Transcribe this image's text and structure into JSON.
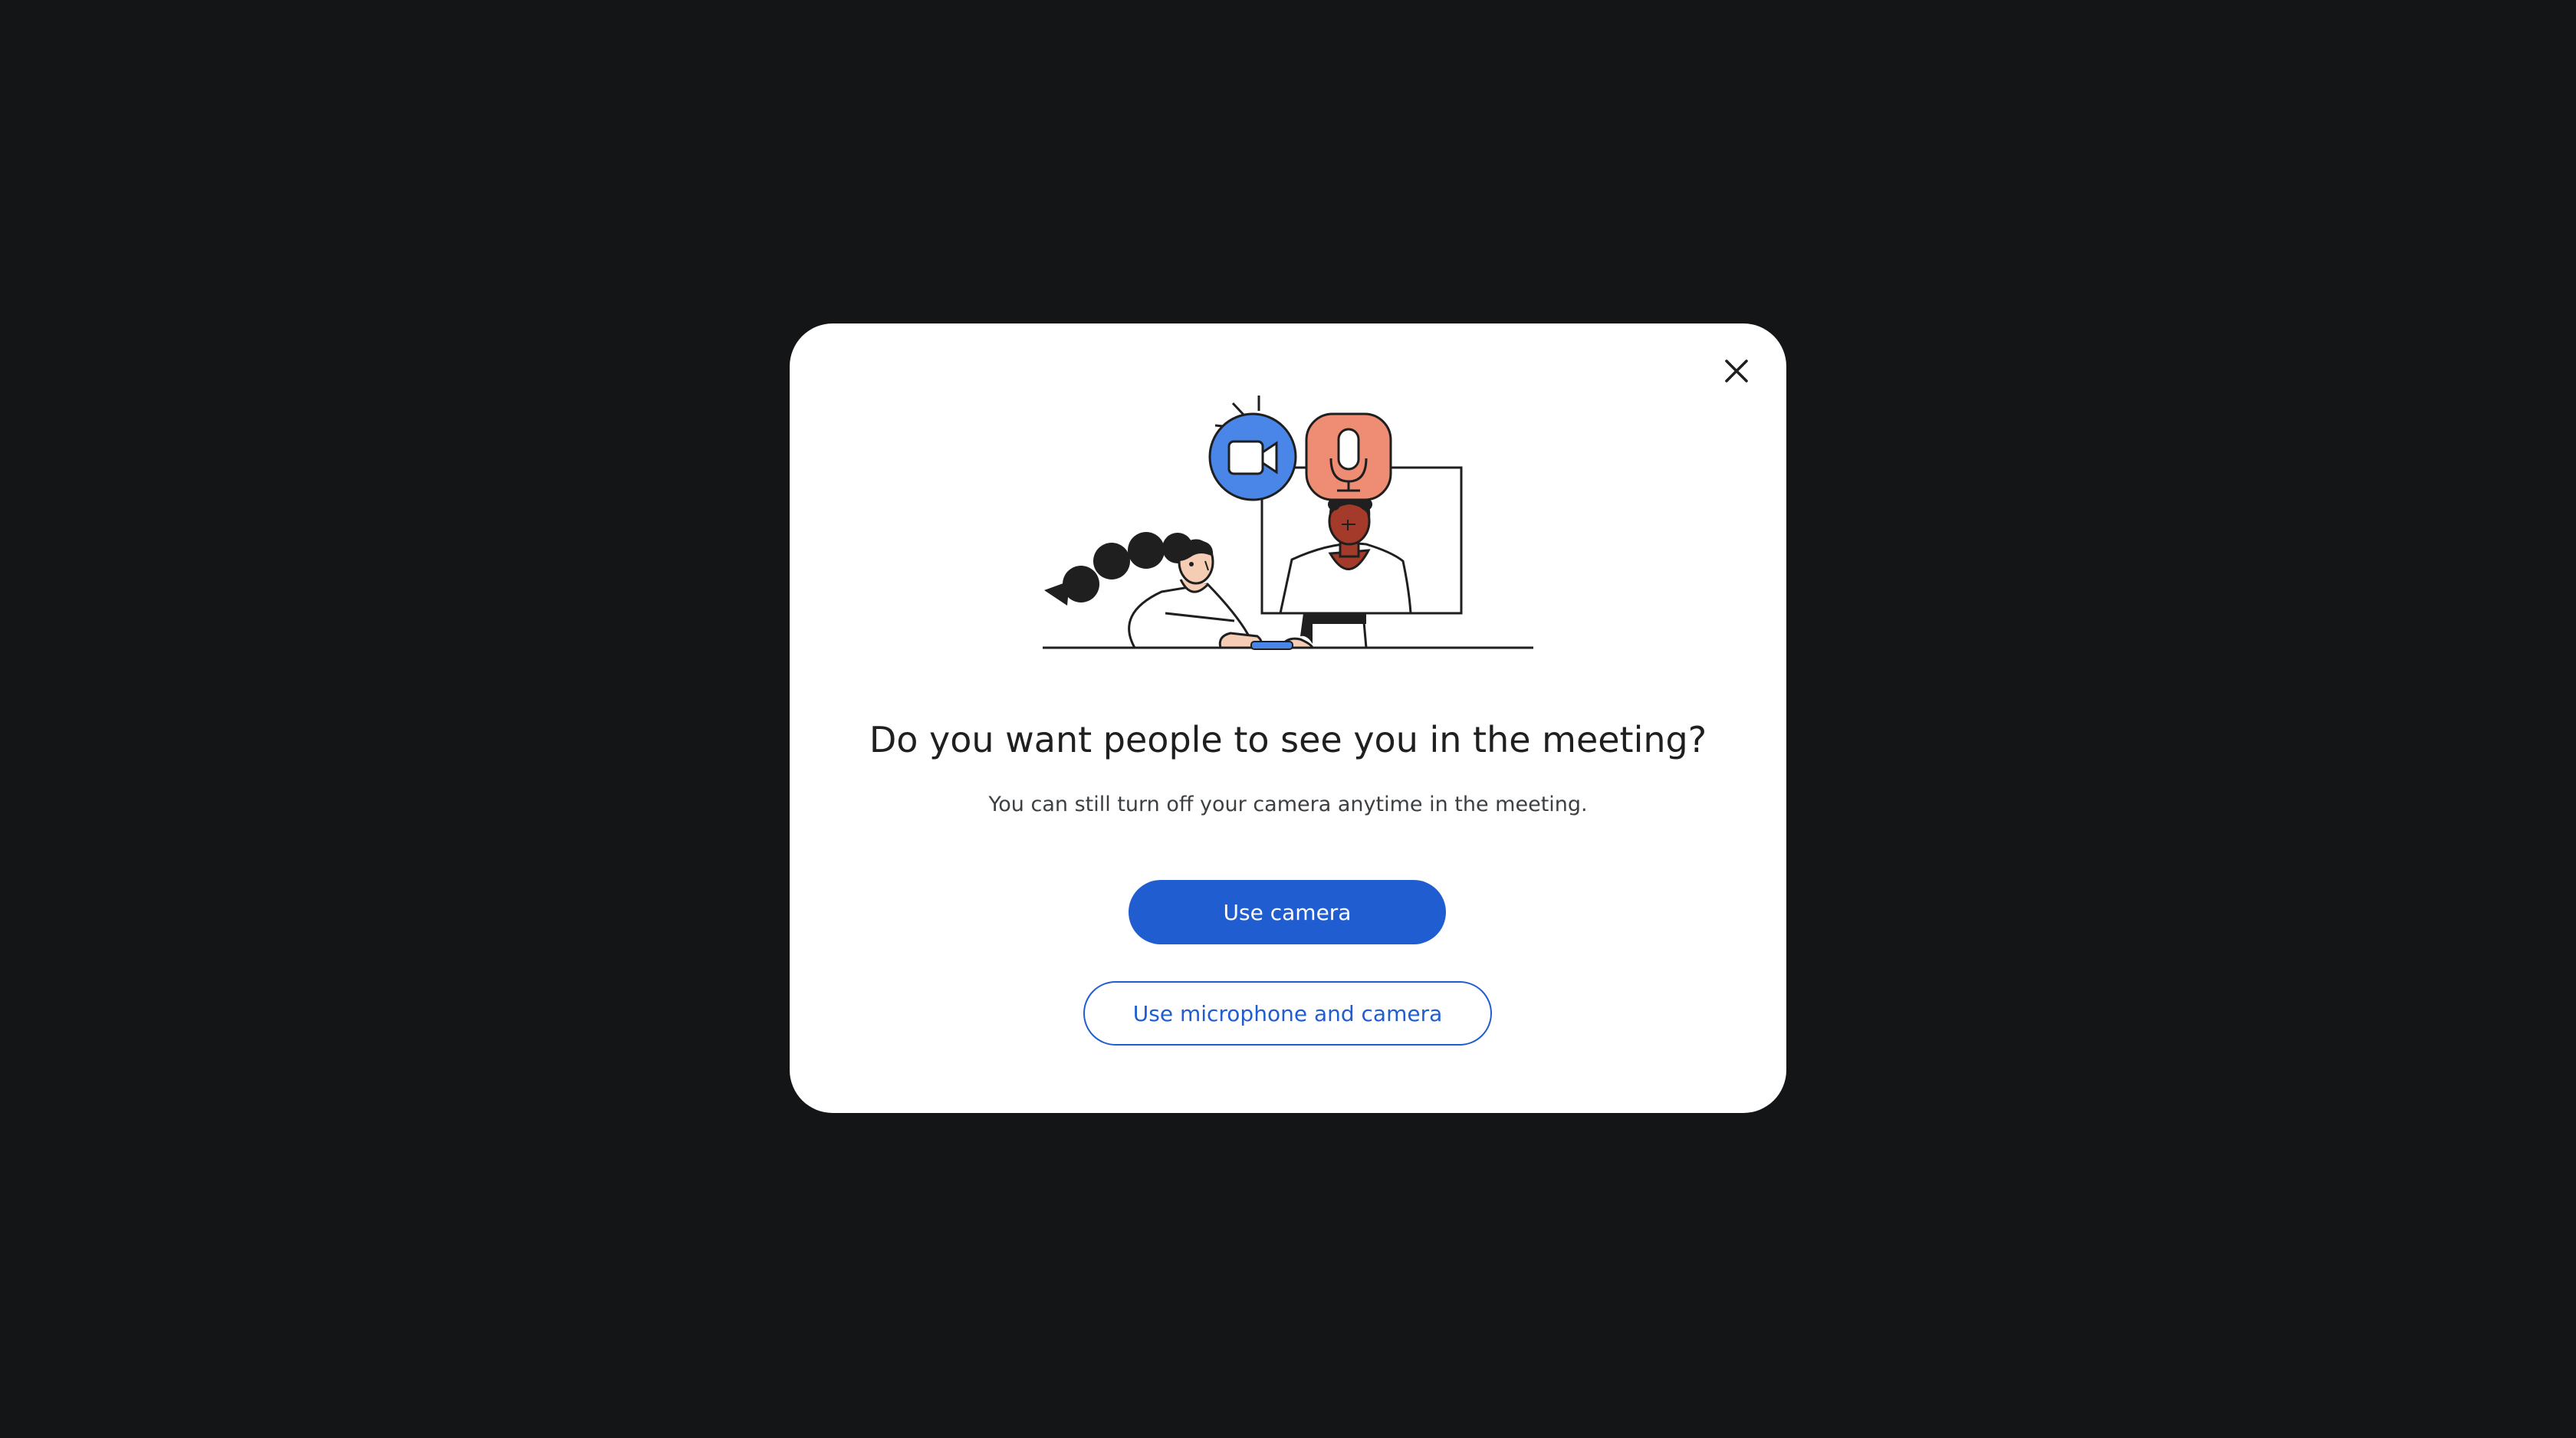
{
  "dialog": {
    "title": "Do you want people to see you in the meeting?",
    "subtitle": "You can still turn off your camera anytime in the meeting.",
    "primary_button": "Use camera",
    "secondary_button": "Use microphone and camera",
    "close_icon": "close-icon"
  },
  "illustration": {
    "camera_icon": "video-camera-icon",
    "microphone_icon": "microphone-icon"
  },
  "colors": {
    "backdrop": "#141517",
    "dialog_bg": "#ffffff",
    "accent": "#1f5dd0",
    "camera_badge": "#4a86e8",
    "mic_badge": "#ee8d74"
  }
}
